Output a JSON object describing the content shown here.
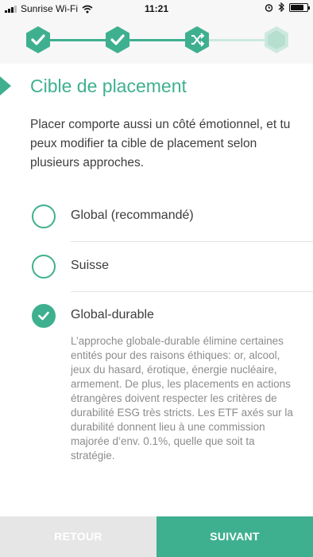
{
  "status_bar": {
    "carrier": "Sunrise Wi-Fi",
    "time": "11:21"
  },
  "progress": {
    "steps": [
      {
        "state": "done",
        "icon": "check-icon"
      },
      {
        "state": "done",
        "icon": "check-icon"
      },
      {
        "state": "current",
        "icon": "shuffle-icon"
      },
      {
        "state": "pending",
        "icon": "hexagon-icon"
      }
    ]
  },
  "page": {
    "title": "Cible de placement",
    "intro": "Placer comporte aussi un côté émotionnel, et tu peux modifier ta cible de placement selon plusieurs approches."
  },
  "options": [
    {
      "label": "Global (recommandé)",
      "selected": false
    },
    {
      "label": "Suisse",
      "selected": false
    },
    {
      "label": "Global-durable",
      "selected": true
    }
  ],
  "selected_description": "L’approche globale-durable élimine certaines entités pour des raisons éthiques: or, alcool, jeux du hasard, érotique, énergie nucléaire, armement. De plus, les placements en actions étrangères doivent respecter les critères de durabilité ESG très stricts. Les ETF axés sur la durabilité donnent lieu à une commission majorée d’env. 0.1%, quelle que soit ta stratégie.",
  "buttons": {
    "back_label": "RETOUR",
    "next_label": "SUIVANT"
  },
  "colors": {
    "accent": "#3fb08f",
    "accent_light": "#cde9de",
    "button_disabled": "#e6e6e6"
  }
}
